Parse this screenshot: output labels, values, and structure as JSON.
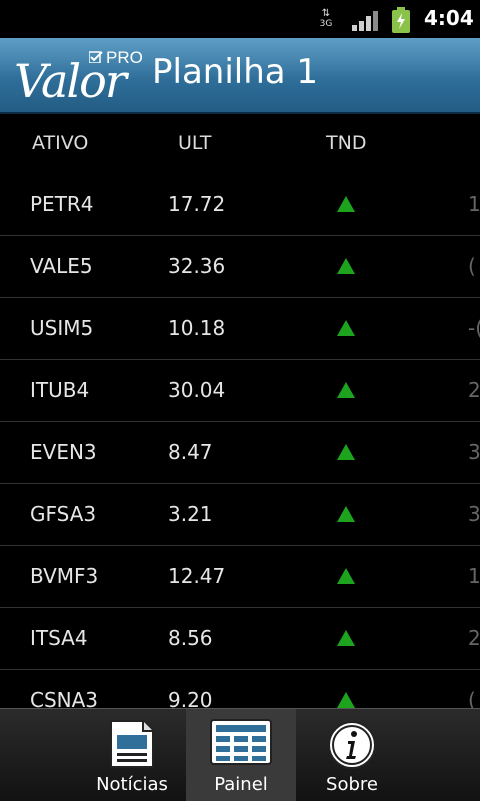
{
  "status": {
    "network": "3G",
    "time": "4:04"
  },
  "header": {
    "logo_main": "Valor",
    "logo_pro": "PRO",
    "title": "Planilha 1"
  },
  "table": {
    "columns": [
      "ATIVO",
      "ULT",
      "TND"
    ],
    "rows": [
      {
        "ativo": "PETR4",
        "ult": "17.72",
        "trend": "up",
        "extra": "1"
      },
      {
        "ativo": "VALE5",
        "ult": "32.36",
        "trend": "up",
        "extra": "("
      },
      {
        "ativo": "USIM5",
        "ult": "10.18",
        "trend": "up",
        "extra": "-("
      },
      {
        "ativo": "ITUB4",
        "ult": "30.04",
        "trend": "up",
        "extra": "2"
      },
      {
        "ativo": "EVEN3",
        "ult": "8.47",
        "trend": "up",
        "extra": "3"
      },
      {
        "ativo": "GFSA3",
        "ult": "3.21",
        "trend": "up",
        "extra": "3"
      },
      {
        "ativo": "BVMF3",
        "ult": "12.47",
        "trend": "up",
        "extra": "1"
      },
      {
        "ativo": "ITSA4",
        "ult": "8.56",
        "trend": "up",
        "extra": "2"
      },
      {
        "ativo": "CSNA3",
        "ult": "9.20",
        "trend": "up",
        "extra": "("
      }
    ],
    "trend_color": "#1ea31e"
  },
  "nav": {
    "tabs": [
      {
        "label": "Notícias",
        "icon": "news-icon"
      },
      {
        "label": "Painel",
        "icon": "grid-icon",
        "active": true
      },
      {
        "label": "Sobre",
        "icon": "info-icon"
      }
    ]
  }
}
